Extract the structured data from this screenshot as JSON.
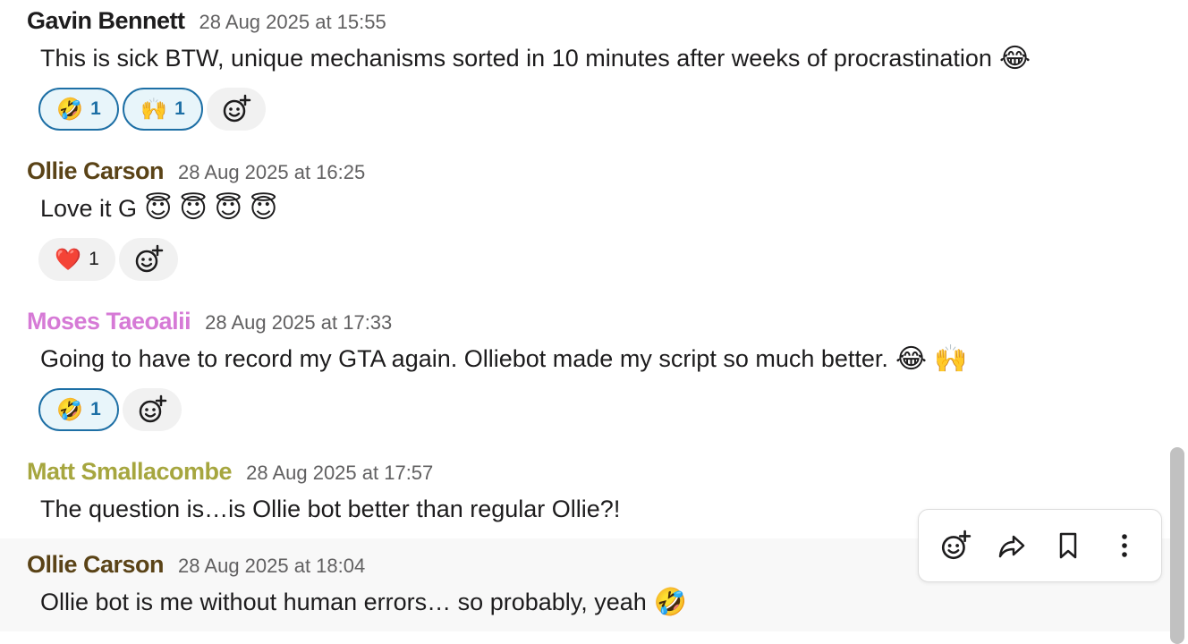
{
  "colors": {
    "gavin": "#1d1c1d",
    "ollie": "#5a4317",
    "moses": "#d67ad6",
    "matt": "#a6a63f",
    "reaction_accent": "#1d6fa5"
  },
  "messages": [
    {
      "author": "Gavin Bennett",
      "timestamp": "28 Aug 2025 at 15:55",
      "text": "This is sick BTW, unique mechanisms sorted in 10 minutes after weeks of procrastination",
      "emojis": [
        "😂"
      ],
      "reactions": [
        {
          "emoji": "🤣",
          "count": "1"
        },
        {
          "emoji": "🙌",
          "count": "1"
        }
      ]
    },
    {
      "author": "Ollie Carson",
      "timestamp": "28 Aug 2025 at 16:25",
      "text": "Love it G",
      "emojis": [
        "😇",
        "😇",
        "😇",
        "😇"
      ],
      "reactions": [
        {
          "emoji": "❤️",
          "count": "1"
        }
      ]
    },
    {
      "author": "Moses Taeoalii",
      "timestamp": "28 Aug 2025 at 17:33",
      "text": "Going to have to record my GTA again. Olliebot made my script so much better.",
      "emojis": [
        "😂",
        "🙌"
      ],
      "reactions": [
        {
          "emoji": "🤣",
          "count": "1"
        }
      ]
    },
    {
      "author": "Matt Smallacombe",
      "timestamp": "28 Aug 2025 at 17:57",
      "text": "The question is…is Ollie bot better than regular Ollie?!"
    },
    {
      "author": "Ollie Carson",
      "timestamp": "28 Aug 2025 at 18:04",
      "text": "Ollie bot is me without human errors… so probably, yeah",
      "emojis": [
        "🤣"
      ]
    }
  ],
  "toolbar": {
    "icons": [
      "add-reaction-icon",
      "share-icon",
      "bookmark-icon",
      "more-icon"
    ]
  }
}
